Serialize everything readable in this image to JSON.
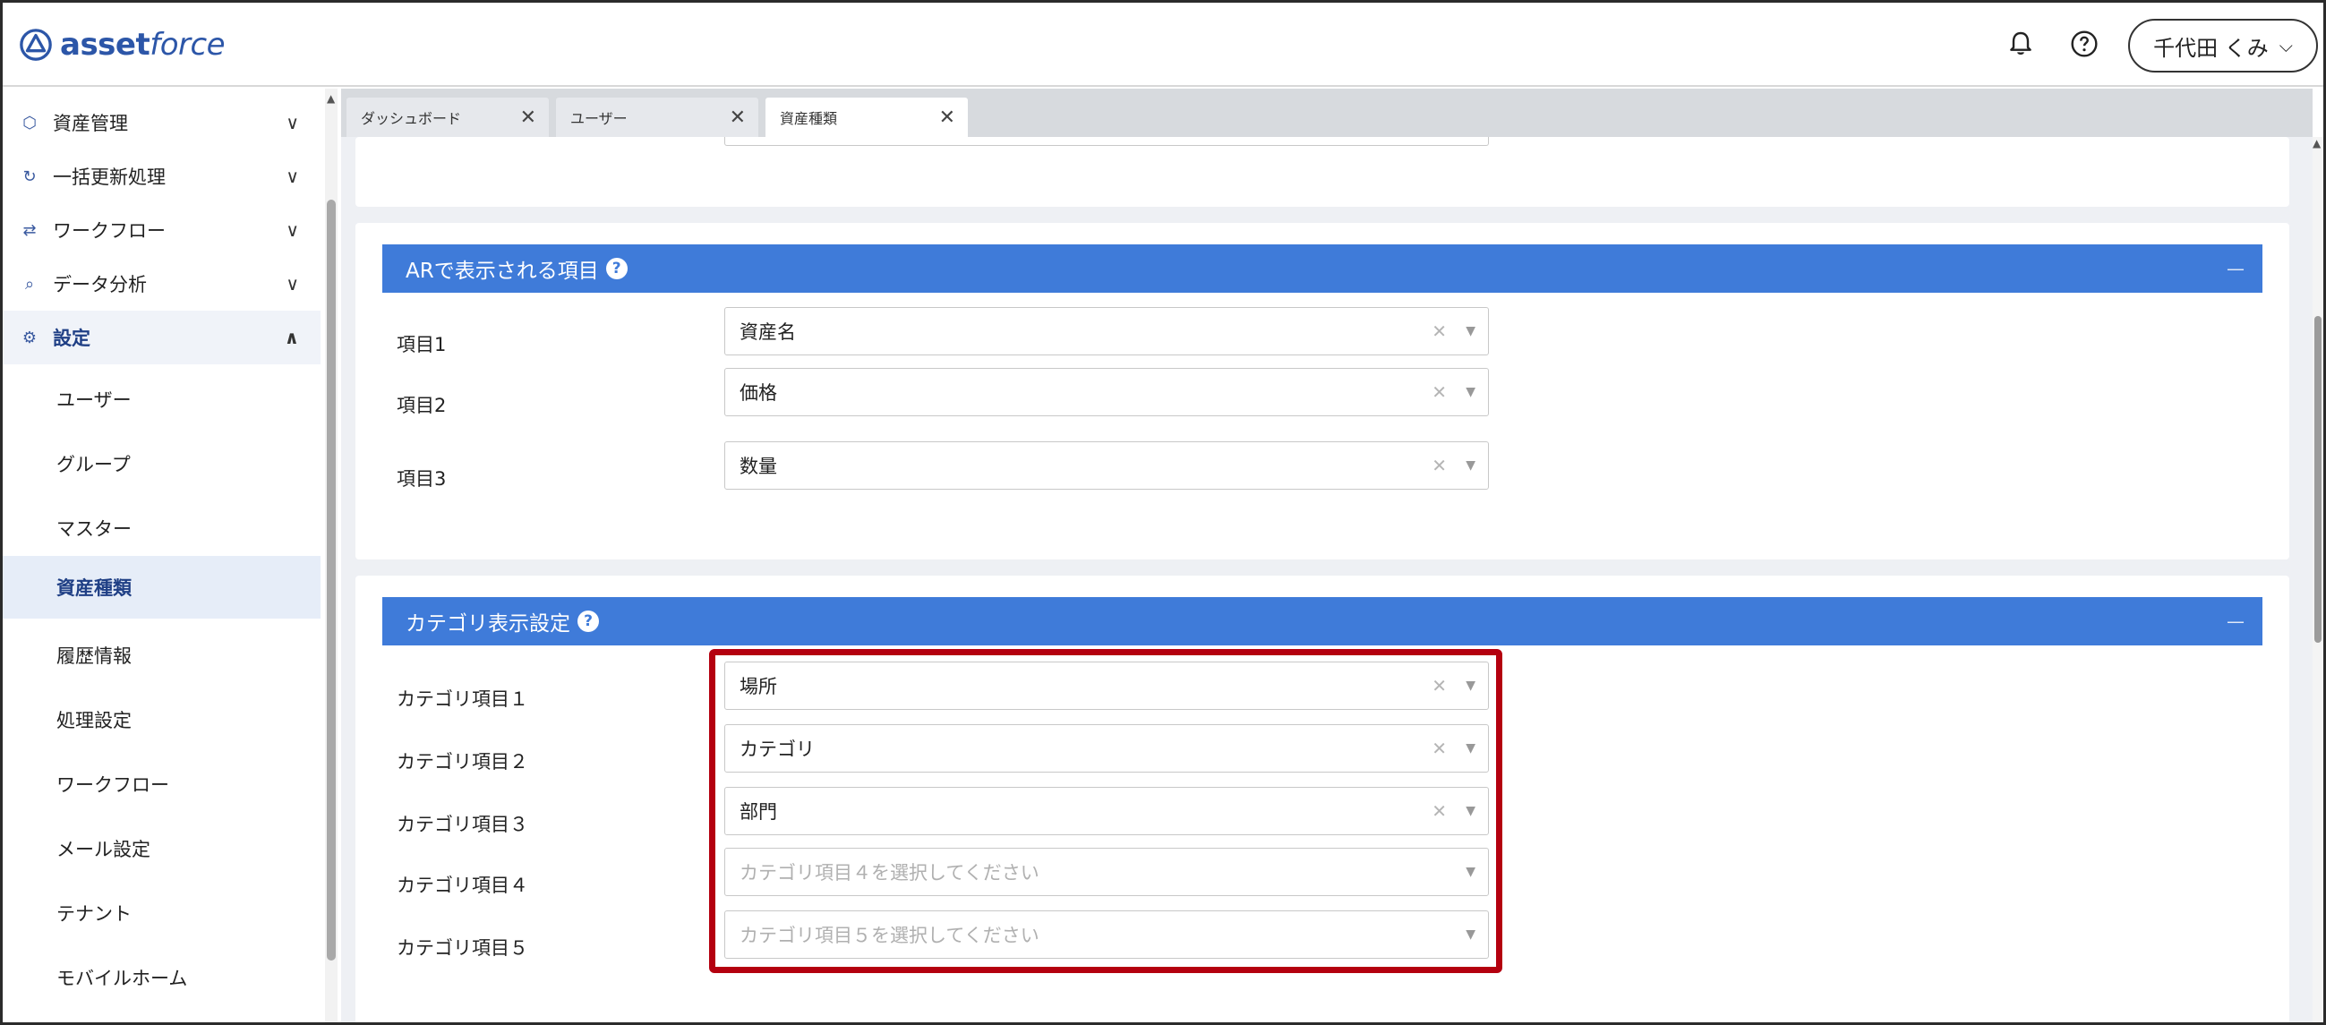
{
  "header": {
    "logo_bold": "asset",
    "logo_italic": "force",
    "user_name": "千代田 くみ",
    "icons": [
      "bell-icon",
      "help-circle-icon",
      "chevron-down-icon"
    ]
  },
  "sidebar": {
    "groups": [
      {
        "label": "資産管理",
        "icon": "cube-icon",
        "expanded": false
      },
      {
        "label": "一括更新処理",
        "icon": "refresh-icon",
        "expanded": false
      },
      {
        "label": "ワークフロー",
        "icon": "workflow-icon",
        "expanded": false
      },
      {
        "label": "データ分析",
        "icon": "analytics-icon",
        "expanded": false
      },
      {
        "label": "設定",
        "icon": "gear-icon",
        "expanded": true
      }
    ],
    "sub_items": [
      {
        "label": "ユーザー"
      },
      {
        "label": "グループ"
      },
      {
        "label": "マスター"
      },
      {
        "label": "資産種類",
        "selected": true
      },
      {
        "label": "履歴情報"
      },
      {
        "label": "処理設定"
      },
      {
        "label": "ワークフロー"
      },
      {
        "label": "メール設定"
      },
      {
        "label": "テナント"
      },
      {
        "label": "モバイルホーム"
      }
    ]
  },
  "tabs": [
    {
      "label": "ダッシュボード",
      "active": false
    },
    {
      "label": "ユーザー",
      "active": false
    },
    {
      "label": "資産種類",
      "active": true
    }
  ],
  "ar_section": {
    "title": "ARで表示される項目",
    "collapse_label": "—",
    "fields": [
      {
        "label": "項目1",
        "value": "資産名"
      },
      {
        "label": "項目2",
        "value": "価格"
      },
      {
        "label": "項目3",
        "value": "数量"
      }
    ]
  },
  "category_section": {
    "title": "カテゴリ表示設定",
    "collapse_label": "—",
    "fields": [
      {
        "label": "カテゴリ項目１",
        "value": "場所",
        "placeholder": ""
      },
      {
        "label": "カテゴリ項目２",
        "value": "カテゴリ",
        "placeholder": ""
      },
      {
        "label": "カテゴリ項目３",
        "value": "部門",
        "placeholder": ""
      },
      {
        "label": "カテゴリ項目４",
        "value": "",
        "placeholder": "カテゴリ項目４を選択してください"
      },
      {
        "label": "カテゴリ項目５",
        "value": "",
        "placeholder": "カテゴリ項目５を選択してください"
      }
    ]
  },
  "colors": {
    "accent": "#3f7bd9",
    "brand": "#2c56a8",
    "highlight": "#b4000f"
  }
}
